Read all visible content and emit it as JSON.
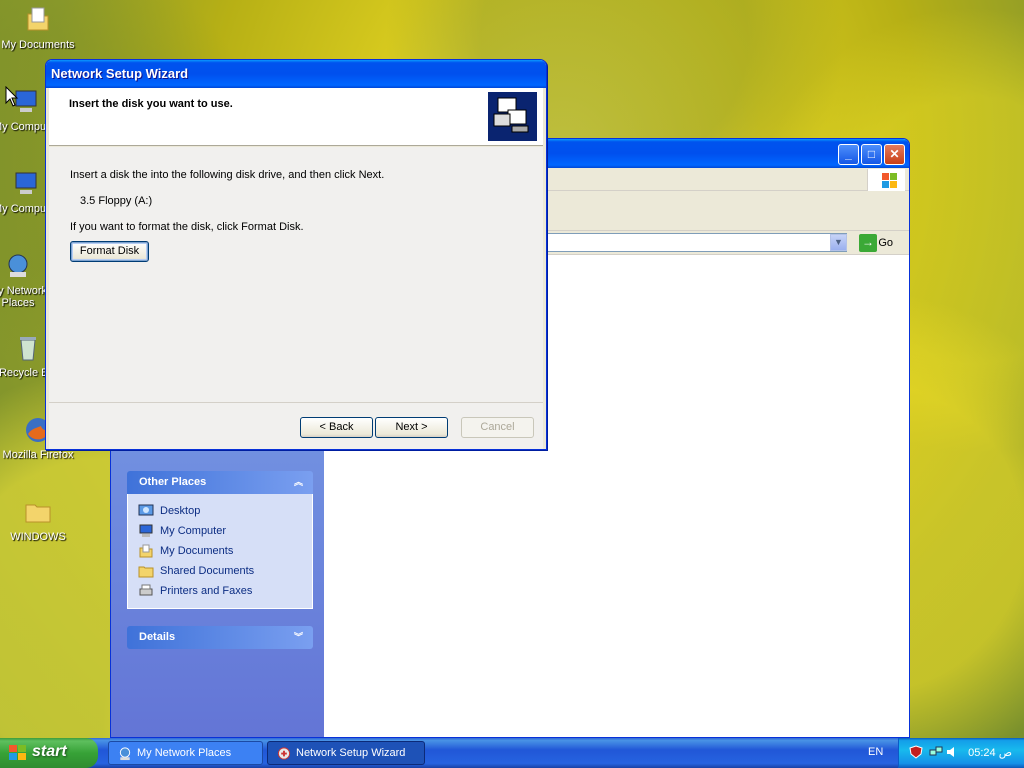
{
  "desktop": {
    "icons": [
      {
        "label": "My Documents"
      },
      {
        "label": "My Computer"
      },
      {
        "label": "My Computer"
      },
      {
        "label": "My Network Places"
      },
      {
        "label": "Recycle Bin"
      },
      {
        "label": "Mozilla Firefox"
      },
      {
        "label": "WINDOWS"
      }
    ]
  },
  "explorer": {
    "go_label": "Go",
    "other_places": {
      "header": "Other Places",
      "items": [
        {
          "label": "Desktop",
          "icon": "desktop-icon"
        },
        {
          "label": "My Computer",
          "icon": "computer-icon"
        },
        {
          "label": "My Documents",
          "icon": "documents-folder-icon"
        },
        {
          "label": "Shared Documents",
          "icon": "folder-icon"
        },
        {
          "label": "Printers and Faxes",
          "icon": "printer-icon"
        }
      ]
    },
    "details": {
      "header": "Details"
    }
  },
  "wizard": {
    "title": "Network Setup Wizard",
    "header_title": "Insert the disk you want to use.",
    "instruction": "Insert a disk the into the following disk drive, and then click Next.",
    "drive": "3.5 Floppy (A:)",
    "format_hint": "If you want to format the disk, click Format Disk.",
    "format_button": "Format Disk",
    "back_button": "< Back",
    "next_button": "Next >",
    "cancel_button": "Cancel"
  },
  "taskbar": {
    "start_label": "start",
    "tasks": [
      {
        "label": "My Network Places",
        "active": false
      },
      {
        "label": "Network Setup Wizard",
        "active": true
      }
    ],
    "language": "EN",
    "clock": "05:24 ص"
  },
  "colors": {
    "xp_blue": "#0054e3",
    "start_green": "#37a237",
    "taskpane_link": "#0c2d83"
  }
}
